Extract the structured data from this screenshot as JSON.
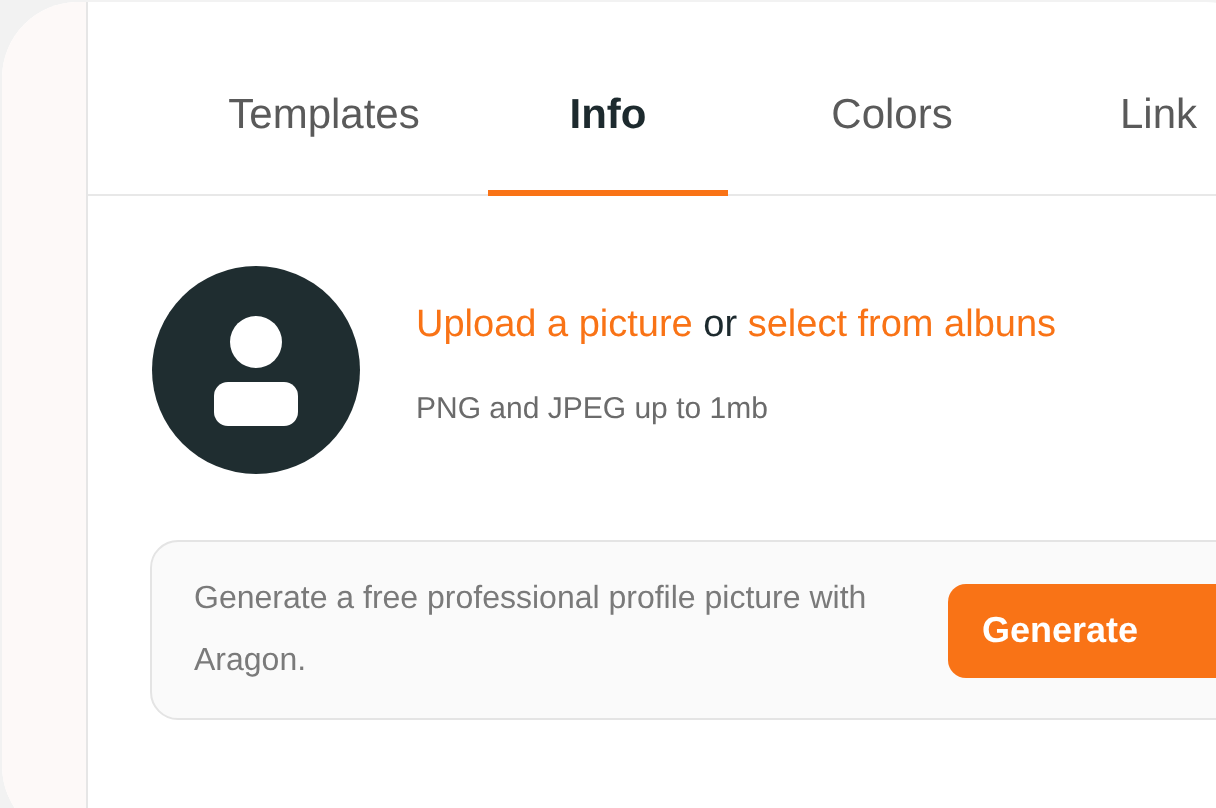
{
  "tabs": [
    {
      "label": "Templates",
      "selected": false
    },
    {
      "label": "Info",
      "selected": true
    },
    {
      "label": "Colors",
      "selected": false
    },
    {
      "label": "Link",
      "selected": false
    }
  ],
  "upload": {
    "upload_link": "Upload a picture",
    "separator": "or",
    "albums_link": "select from albuns",
    "hint": "PNG and JPEG up to 1mb"
  },
  "promo": {
    "text": "Generate a free professional profile picture with Aragon.",
    "button": "Generate"
  }
}
